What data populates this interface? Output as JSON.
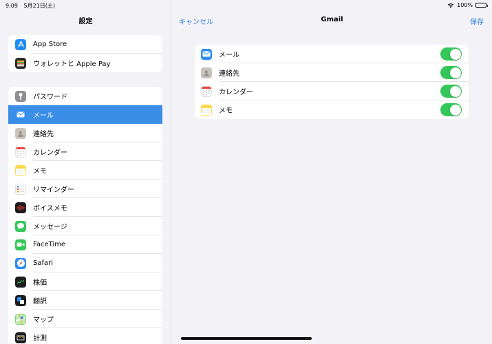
{
  "status_bar": {
    "time": "9:09",
    "date": "5月21日(土)",
    "battery": "100%"
  },
  "sidebar": {
    "title": "設定",
    "group_a": [
      {
        "label": "App Store",
        "icon": "app-store-icon",
        "color": "#1f8cf3"
      },
      {
        "label": "ウォレットと Apple Pay",
        "icon": "wallet-icon",
        "color": "#2b2b2b"
      }
    ],
    "group_b": [
      {
        "label": "パスワード",
        "icon": "key-icon",
        "color": "#8e8e93"
      },
      {
        "label": "メール",
        "icon": "mail-icon",
        "color": "#2f8cf5",
        "selected": true
      },
      {
        "label": "連絡先",
        "icon": "contacts-icon",
        "color": "#c8c3bc"
      },
      {
        "label": "カレンダー",
        "icon": "calendar-icon",
        "color": "#ffffff"
      },
      {
        "label": "メモ",
        "icon": "notes-icon",
        "color": "#ffd84a"
      },
      {
        "label": "リマインダー",
        "icon": "reminders-icon",
        "color": "#ffffff"
      },
      {
        "label": "ボイスメモ",
        "icon": "voice-memos-icon",
        "color": "#1c1c1e"
      },
      {
        "label": "メッセージ",
        "icon": "messages-icon",
        "color": "#34c759"
      },
      {
        "label": "FaceTime",
        "icon": "facetime-icon",
        "color": "#34c759"
      },
      {
        "label": "Safari",
        "icon": "safari-icon",
        "color": "#2f8cf5"
      },
      {
        "label": "株価",
        "icon": "stocks-icon",
        "color": "#1c1c1e"
      },
      {
        "label": "翻訳",
        "icon": "translate-icon",
        "color": "#1c1c1e"
      },
      {
        "label": "マップ",
        "icon": "maps-icon",
        "color": "#7dd07a"
      },
      {
        "label": "計測",
        "icon": "measure-icon",
        "color": "#1c1c1e"
      }
    ]
  },
  "detail": {
    "cancel_label": "キャンセル",
    "title": "Gmail",
    "save_label": "保存",
    "items": [
      {
        "label": "メール",
        "icon": "mail-icon",
        "color": "#2f8cf5",
        "enabled": true
      },
      {
        "label": "連絡先",
        "icon": "contacts-icon",
        "color": "#c8c3bc",
        "enabled": true
      },
      {
        "label": "カレンダー",
        "icon": "calendar-icon",
        "color": "#ffffff",
        "enabled": true
      },
      {
        "label": "メモ",
        "icon": "notes-icon",
        "color": "#ffd84a",
        "enabled": true
      }
    ]
  }
}
